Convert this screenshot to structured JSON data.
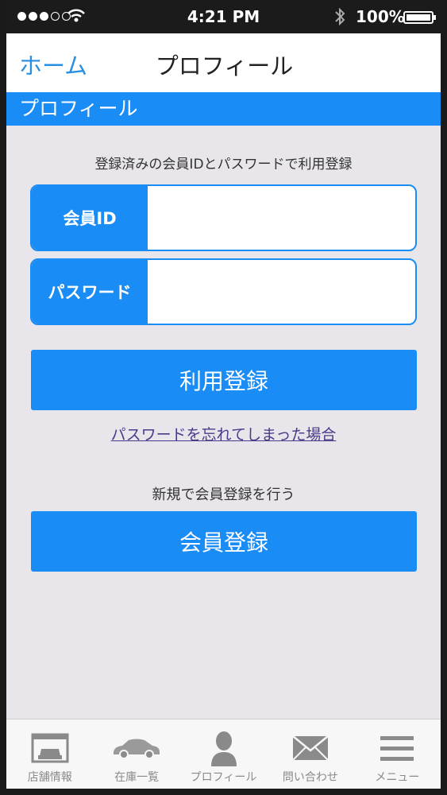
{
  "status_bar": {
    "time": "4:21 PM",
    "battery": "100%"
  },
  "nav": {
    "back_label": "ホーム",
    "title": "プロフィール"
  },
  "section": {
    "header": "プロフィール"
  },
  "login": {
    "instruction": "登録済みの会員IDとパスワードで利用登録",
    "id_label": "会員ID",
    "id_value": "",
    "password_label": "パスワード",
    "password_value": "",
    "submit_label": "利用登録",
    "forgot_link": "パスワードを忘れてしまった場合"
  },
  "register": {
    "text": "新規で会員登録を行う",
    "button_label": "会員登録"
  },
  "tabs": [
    {
      "label": "店舗情報",
      "icon": "garage-icon"
    },
    {
      "label": "在庫一覧",
      "icon": "car-icon"
    },
    {
      "label": "プロフィール",
      "icon": "person-icon"
    },
    {
      "label": "問い合わせ",
      "icon": "envelope-icon"
    },
    {
      "label": "メニュー",
      "icon": "menu-icon"
    }
  ],
  "colors": {
    "accent": "#1a8cf5",
    "link": "#2a8fe0",
    "background": "#e8e6ea"
  }
}
